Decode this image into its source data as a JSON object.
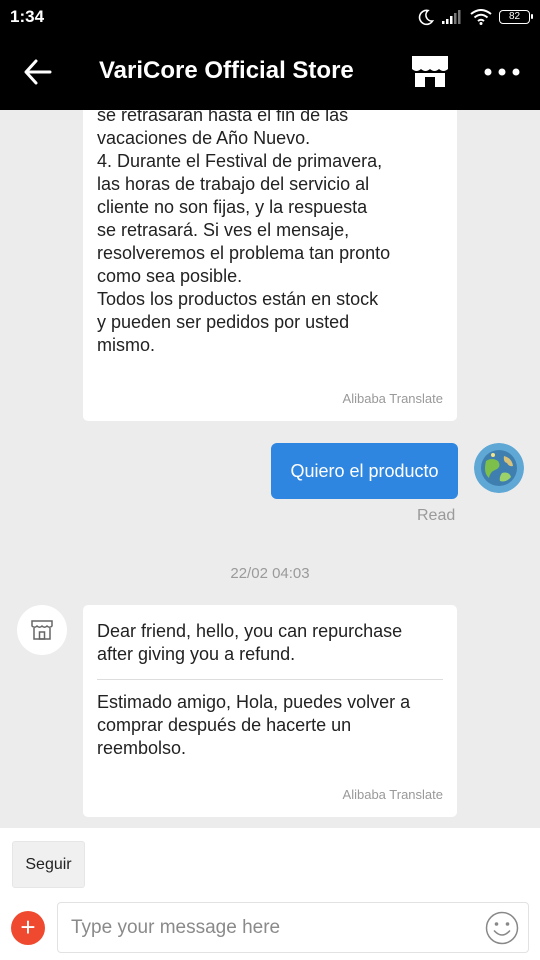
{
  "status_bar": {
    "time": "1:34",
    "battery": "82",
    "icons": [
      "moon-icon",
      "signal-icon",
      "wifi-icon",
      "battery-icon"
    ]
  },
  "app_bar": {
    "title": "VariCore Official Store",
    "icons": [
      "back-arrow-icon",
      "store-icon",
      "more-icon"
    ]
  },
  "messages": [
    {
      "side": "left",
      "text": "se retrasarán hasta el fin de las\nvacaciones de Año Nuevo.\n4. Durante el Festival de primavera,\nlas horas de trabajo del servicio al\ncliente no son fijas, y la respuesta\nse retrasará. Si ves el mensaje,\nresolveremos el problema tan pronto\ncomo sea posible.\nTodos los productos están en stock\ny pueden ser pedidos por usted\nmismo.",
      "translate_label": "Alibaba Translate"
    },
    {
      "side": "right",
      "text": "Quiero el producto",
      "status": "Read"
    },
    {
      "side": "left",
      "date": "22/02 04:03",
      "text": "Dear friend, hello, you can repurchase after giving you a refund.",
      "translation": "Estimado amigo, Hola, puedes volver a comprar después de hacerte un reembolso.",
      "translate_label": "Alibaba Translate"
    }
  ],
  "footer": {
    "follow_button": "Seguir",
    "input_placeholder": "Type your message here",
    "plus_icon": "plus-icon",
    "emoji_icon": "smiley-icon"
  },
  "colors": {
    "accent": "#2f86e0",
    "plus": "#ef4a2f",
    "header": "#000000",
    "chat_bg": "#ececec"
  }
}
